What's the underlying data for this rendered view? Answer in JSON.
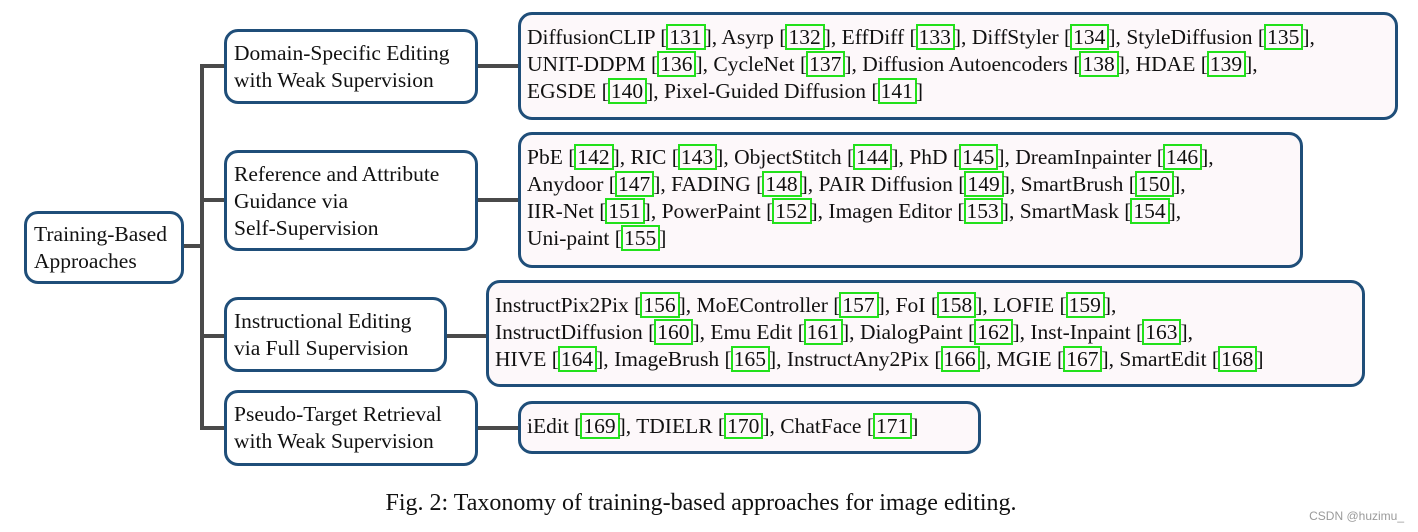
{
  "root": {
    "label_lines": [
      "Training-Based",
      "Approaches"
    ]
  },
  "categories": [
    {
      "label_lines": [
        "Domain-Specific Editing",
        "with Weak Supervision"
      ],
      "methods_lines": [
        [
          [
            "DiffusionCLIP",
            "131"
          ],
          [
            "Asyrp",
            "132"
          ],
          [
            "EffDiff",
            "133"
          ],
          [
            "DiffStyler",
            "134"
          ],
          [
            "StyleDiffusion",
            "135"
          ]
        ],
        [
          [
            "UNIT-DDPM",
            "136"
          ],
          [
            "CycleNet",
            "137"
          ],
          [
            "Diffusion Autoencoders",
            "138"
          ],
          [
            "HDAE",
            "139"
          ]
        ],
        [
          [
            "EGSDE",
            "140"
          ],
          [
            "Pixel-Guided Diffusion",
            "141"
          ]
        ]
      ]
    },
    {
      "label_lines": [
        "Reference and Attribute",
        "Guidance via",
        "Self-Supervision"
      ],
      "methods_lines": [
        [
          [
            "PbE",
            "142"
          ],
          [
            "RIC",
            "143"
          ],
          [
            "ObjectStitch",
            "144"
          ],
          [
            "PhD",
            "145"
          ],
          [
            "DreamInpainter",
            "146"
          ]
        ],
        [
          [
            "Anydoor",
            "147"
          ],
          [
            "FADING",
            "148"
          ],
          [
            "PAIR Diffusion",
            "149"
          ],
          [
            "SmartBrush",
            "150"
          ]
        ],
        [
          [
            "IIR-Net",
            "151"
          ],
          [
            "PowerPaint",
            "152"
          ],
          [
            "Imagen Editor",
            "153"
          ],
          [
            "SmartMask",
            "154"
          ]
        ],
        [
          [
            "Uni-paint",
            "155"
          ]
        ]
      ]
    },
    {
      "label_lines": [
        "Instructional Editing",
        "via Full Supervision"
      ],
      "methods_lines": [
        [
          [
            "InstructPix2Pix",
            "156"
          ],
          [
            "MoEController",
            "157"
          ],
          [
            "FoI",
            "158"
          ],
          [
            "LOFIE",
            "159"
          ]
        ],
        [
          [
            "InstructDiffusion",
            "160"
          ],
          [
            "Emu Edit",
            "161"
          ],
          [
            "DialogPaint",
            "162"
          ],
          [
            "Inst-Inpaint",
            "163"
          ]
        ],
        [
          [
            "HIVE",
            "164"
          ],
          [
            "ImageBrush",
            "165"
          ],
          [
            "InstructAny2Pix",
            "166"
          ],
          [
            "MGIE",
            "167"
          ],
          [
            "SmartEdit",
            "168"
          ]
        ]
      ]
    },
    {
      "label_lines": [
        "Pseudo-Target Retrieval",
        "with Weak Supervision"
      ],
      "methods_lines": [
        [
          [
            "iEdit",
            "169"
          ],
          [
            "TDIELR",
            "170"
          ],
          [
            "ChatFace",
            "171"
          ]
        ]
      ]
    }
  ],
  "caption": "Fig. 2: Taxonomy of training-based approaches for image editing.",
  "watermark": "CSDN @huzimu_",
  "colors": {
    "box_border": "#1f4e79",
    "leaf_fill": "#fdf8fa",
    "ref_highlight": "#22e11b",
    "connector": "#4a4a4a"
  }
}
